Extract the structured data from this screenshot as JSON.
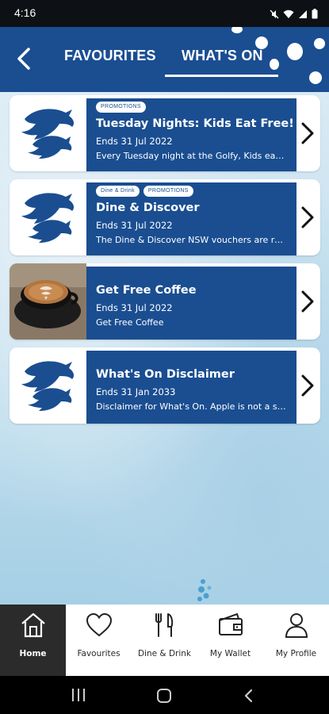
{
  "status": {
    "time": "4:16"
  },
  "header": {
    "tabs": [
      {
        "label": "FAVOURITES"
      },
      {
        "label": "WHAT'S ON"
      }
    ],
    "active_tab": "WHAT'S ON"
  },
  "cards": [
    {
      "tags": [
        "PROMOTIONS"
      ],
      "title": "Tuesday Nights: Kids Eat Free!",
      "ends": "Ends 31 Jul 2022",
      "description": "Every Tuesday night at the Golfy, Kids eat ...",
      "thumb": "dolphin-logo"
    },
    {
      "tags": [
        "Dine & Drink",
        "PROMOTIONS"
      ],
      "title": "Dine & Discover",
      "ends": "Ends 31 Jul 2022",
      "description": "The Dine & Discover NSW vouchers are re...",
      "thumb": "dolphin-logo"
    },
    {
      "tags": [],
      "title": "Get Free Coffee",
      "ends": "Ends 31 Jul 2022",
      "description": "Get Free Coffee",
      "thumb": "coffee-photo"
    },
    {
      "tags": [],
      "title": "What's On Disclaimer",
      "ends": "Ends 31 Jan 2033",
      "description": "Disclaimer for What's On. Apple is not a sp...",
      "thumb": "dolphin-logo"
    }
  ],
  "bottom_nav": [
    {
      "label": "Home",
      "icon": "home-icon",
      "active": true
    },
    {
      "label": "Favourites",
      "icon": "heart-icon",
      "active": false
    },
    {
      "label": "Dine & Drink",
      "icon": "utensils-icon",
      "active": false
    },
    {
      "label": "My Wallet",
      "icon": "wallet-icon",
      "active": false
    },
    {
      "label": "My Profile",
      "icon": "user-icon",
      "active": false
    }
  ],
  "colors": {
    "brand_blue": "#1a4e91",
    "nav_active": "#2b2b2b"
  }
}
